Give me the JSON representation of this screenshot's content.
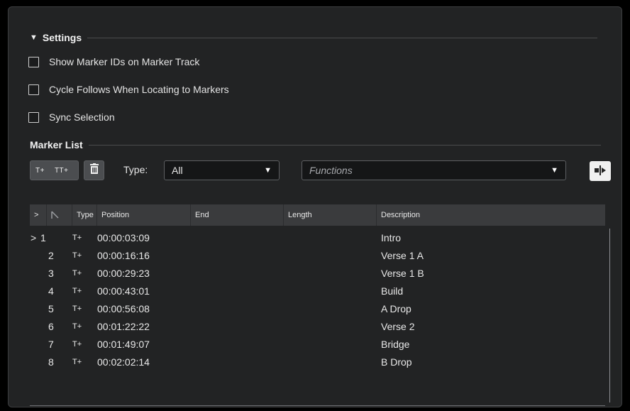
{
  "settings": {
    "title": "Settings",
    "options": [
      {
        "label": "Show Marker IDs on Marker Track",
        "checked": false
      },
      {
        "label": "Cycle Follows When Locating to Markers",
        "checked": false
      },
      {
        "label": "Sync Selection",
        "checked": false
      }
    ]
  },
  "marker_list": {
    "title": "Marker List",
    "insert_marker": "T+",
    "insert_marker_ids": "TT+",
    "type_label": "Type:",
    "type_value": "All",
    "functions_placeholder": "Functions"
  },
  "table": {
    "columns": [
      ">",
      "",
      "Type",
      "Position",
      "End",
      "Length",
      "Description"
    ],
    "rows": [
      {
        "cursor": ">",
        "id": "1",
        "type": "T+",
        "position": "00:00:03:09",
        "end": "",
        "length": "",
        "description": "Intro"
      },
      {
        "cursor": "",
        "id": "2",
        "type": "T+",
        "position": "00:00:16:16",
        "end": "",
        "length": "",
        "description": "Verse 1 A"
      },
      {
        "cursor": "",
        "id": "3",
        "type": "T+",
        "position": "00:00:29:23",
        "end": "",
        "length": "",
        "description": "Verse 1 B"
      },
      {
        "cursor": "",
        "id": "4",
        "type": "T+",
        "position": "00:00:43:01",
        "end": "",
        "length": "",
        "description": "Build"
      },
      {
        "cursor": "",
        "id": "5",
        "type": "T+",
        "position": "00:00:56:08",
        "end": "",
        "length": "",
        "description": "A Drop"
      },
      {
        "cursor": "",
        "id": "6",
        "type": "T+",
        "position": "00:01:22:22",
        "end": "",
        "length": "",
        "description": "Verse 2"
      },
      {
        "cursor": "",
        "id": "7",
        "type": "T+",
        "position": "00:01:49:07",
        "end": "",
        "length": "",
        "description": "Bridge"
      },
      {
        "cursor": "",
        "id": "8",
        "type": "T+",
        "position": "00:02:02:14",
        "end": "",
        "length": "",
        "description": "B Drop"
      }
    ]
  }
}
